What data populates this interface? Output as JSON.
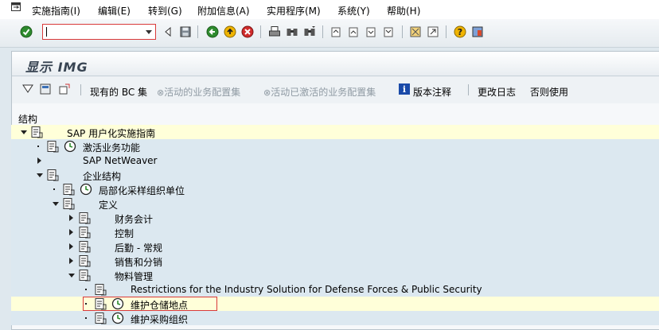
{
  "menubar": {
    "items": [
      "实施指南(I)",
      "编辑(E)",
      "转到(G)",
      "附加信息(A)",
      "实用程序(M)",
      "系统(Y)",
      "帮助(H)"
    ]
  },
  "toolbar": {
    "command_field": {
      "value": "",
      "placeholder": ""
    }
  },
  "panel": {
    "title": "显示 IMG",
    "app_toolbar": {
      "bc_sets": "现有的 BC 集",
      "active_bc_sets": "活动的业务配置集",
      "activated_bc_sets": "活动已激活的业务配置集",
      "release_notes": "版本注释",
      "change_log": "更改日志",
      "other_usage": "否则使用"
    },
    "structure_label": "结构"
  },
  "tree": {
    "nodes": [
      {
        "label": "SAP 用户化实施指南",
        "level": 0,
        "expander": "open",
        "highlighted": true
      },
      {
        "label": "激活业务功能",
        "level": 1,
        "expander": "leaf",
        "clock": true
      },
      {
        "label": "SAP NetWeaver",
        "level": 1,
        "expander": "closed"
      },
      {
        "label": "企业结构",
        "level": 1,
        "expander": "open"
      },
      {
        "label": "局部化采样组织单位",
        "level": 2,
        "expander": "leaf",
        "clock": true
      },
      {
        "label": "定义",
        "level": 2,
        "expander": "open"
      },
      {
        "label": "财务会计",
        "level": 3,
        "expander": "closed"
      },
      {
        "label": "控制",
        "level": 3,
        "expander": "closed"
      },
      {
        "label": "后勤 - 常规",
        "level": 3,
        "expander": "closed"
      },
      {
        "label": "销售和分销",
        "level": 3,
        "expander": "closed"
      },
      {
        "label": "物料管理",
        "level": 3,
        "expander": "open"
      },
      {
        "label": "Restrictions for the Industry Solution for Defense Forces & Public Security",
        "level": 4,
        "expander": "leaf"
      },
      {
        "label": "维护仓储地点",
        "level": 4,
        "expander": "leaf",
        "clock": true,
        "highlighted": true,
        "selected": true
      },
      {
        "label": "维护采购组织",
        "level": 4,
        "expander": "leaf",
        "clock": true
      }
    ]
  },
  "colors": {
    "selection_border": "#d93a3a",
    "highlight_row": "#ffffd9",
    "tree_row": "#dce8f0"
  }
}
